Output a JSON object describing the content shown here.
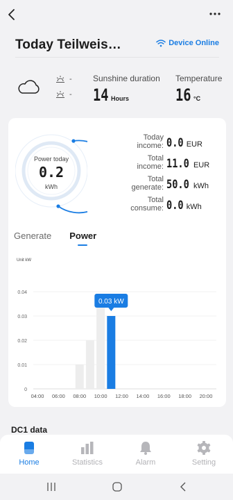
{
  "header": {
    "title": "Today  Teilweis…",
    "status_label": "Device Online"
  },
  "weather": {
    "sunrise_value": "-",
    "sunset_value": "-",
    "sunshine": {
      "label": "Sunshine duration",
      "value": "14",
      "unit": "Hours"
    },
    "temperature": {
      "label": "Temperature",
      "value": "16",
      "unit": "°C"
    }
  },
  "gauge": {
    "label": "Power today",
    "value": "0.2",
    "unit": "kWh"
  },
  "stats": [
    {
      "label_line1": "Today",
      "label_line2": "income:",
      "value": "0.0",
      "unit": "EUR"
    },
    {
      "label_line1": "Total",
      "label_line2": "income:",
      "value": "11.0",
      "unit": "EUR"
    },
    {
      "label_line1": "Total",
      "label_line2": "generate:",
      "value": "50.0",
      "unit": "kWh"
    },
    {
      "label_line1": "Total",
      "label_line2": "consume:",
      "value": "0.0",
      "unit": "kWh"
    }
  ],
  "tabs": [
    {
      "label": "Generate",
      "active": false
    },
    {
      "label": "Power",
      "active": true
    }
  ],
  "chart_unit_label": "Unit kW",
  "chart_data": {
    "type": "bar",
    "categories": [
      "04:00",
      "06:00",
      "08:00",
      "10:00",
      "12:00",
      "14:00",
      "16:00",
      "18:00",
      "20:00"
    ],
    "bars": [
      {
        "x": "08:00",
        "value": 0.01,
        "highlight": false
      },
      {
        "x": "09:00",
        "value": 0.02,
        "highlight": false
      },
      {
        "x": "10:00",
        "value": 0.035,
        "highlight": false
      },
      {
        "x": "11:00",
        "value": 0.03,
        "highlight": true
      }
    ],
    "tooltip": "0.03 kW",
    "yticks": [
      "0",
      "0.01",
      "0.02",
      "0.03",
      "0.04"
    ],
    "ylim": [
      0,
      0.04
    ],
    "accent": "#1a7de3",
    "bar_color": "#ededed"
  },
  "section_title": "DC1 data",
  "nav": [
    {
      "label": "Home",
      "icon": "home-icon",
      "active": true
    },
    {
      "label": "Statistics",
      "icon": "statistics-icon",
      "active": false
    },
    {
      "label": "Alarm",
      "icon": "bell-icon",
      "active": false
    },
    {
      "label": "Setting",
      "icon": "gear-icon",
      "active": false
    }
  ],
  "colors": {
    "accent": "#1a7de3",
    "background": "#f2f2f4",
    "card": "#ffffff"
  }
}
